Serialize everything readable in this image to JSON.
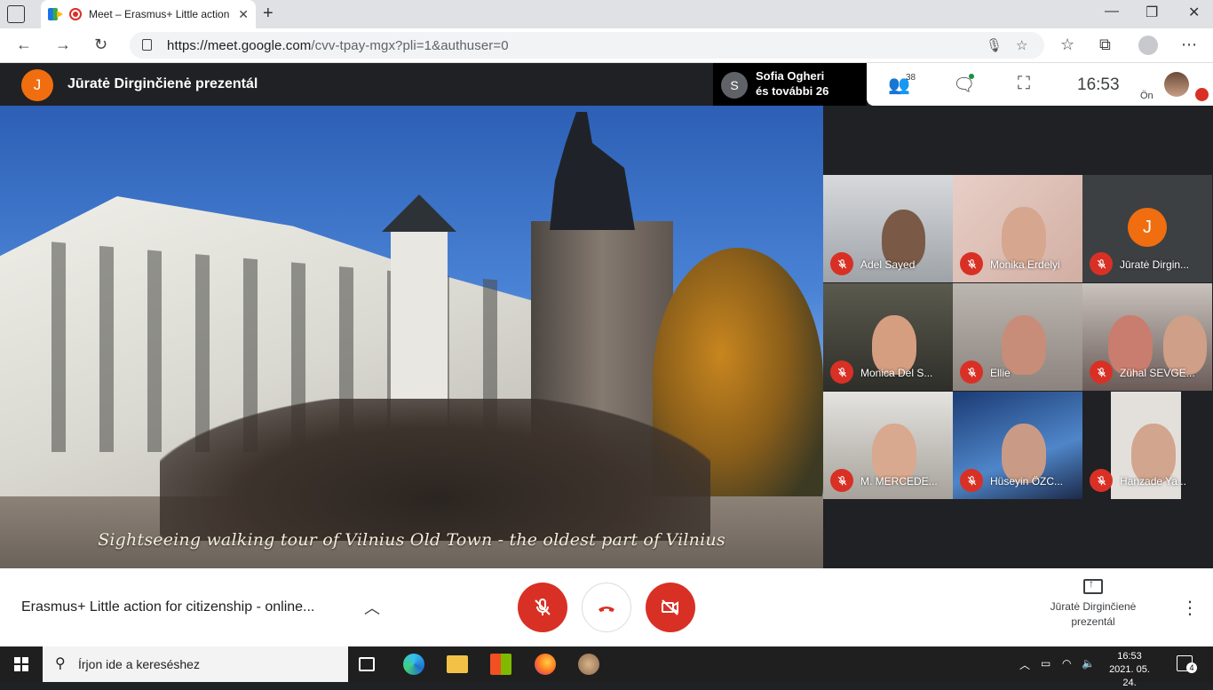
{
  "browser": {
    "tab_title": "Meet – Erasmus+ Little action for citizenship",
    "url_host": "https://meet.google.com",
    "url_path": "/cvv-tpay-mgx?pli=1&authuser=0",
    "new_tab": "+",
    "close": "✕",
    "minimize": "—",
    "maximize": "❐",
    "close_window": "✕"
  },
  "meet_header": {
    "presenter_initial": "J",
    "presenting_title": "Jūratė Dirginčienė prezentál",
    "speaker_initial": "S",
    "speaker_name": "Sofia Ogheri",
    "speaker_more": "és további 26",
    "people_count": "38",
    "clock": "16:53",
    "self_label": "Ön"
  },
  "presentation": {
    "caption": "Sightseeing walking tour of Vilnius Old Town - the oldest part of Vilnius"
  },
  "participants": [
    {
      "name": "Adel Sayed"
    },
    {
      "name": "Monika Erdelyi"
    },
    {
      "name": "Jūratė Dirgin...",
      "initial": "J"
    },
    {
      "name": "Monica Del S..."
    },
    {
      "name": "Ellie"
    },
    {
      "name": "Zühal SEVGE..."
    },
    {
      "name": "M. MERCEDE..."
    },
    {
      "name": "Hüseyin ÖZC..."
    },
    {
      "name": "Hanzade Ya..."
    }
  ],
  "bottom_bar": {
    "meeting_title": "Erasmus+ Little action for citizenship - online...",
    "chevron": "︿",
    "present_label": "Jūratė Dirginčienė prezentál",
    "more": "⋮"
  },
  "taskbar": {
    "search_placeholder": "Írjon ide a kereséshez",
    "time": "16:53",
    "date": "2021. 05. 24.",
    "notification_count": "4"
  },
  "colors": {
    "mute_red": "#d93025",
    "presenter_orange": "#f06e0f",
    "meet_dark": "#202124"
  }
}
